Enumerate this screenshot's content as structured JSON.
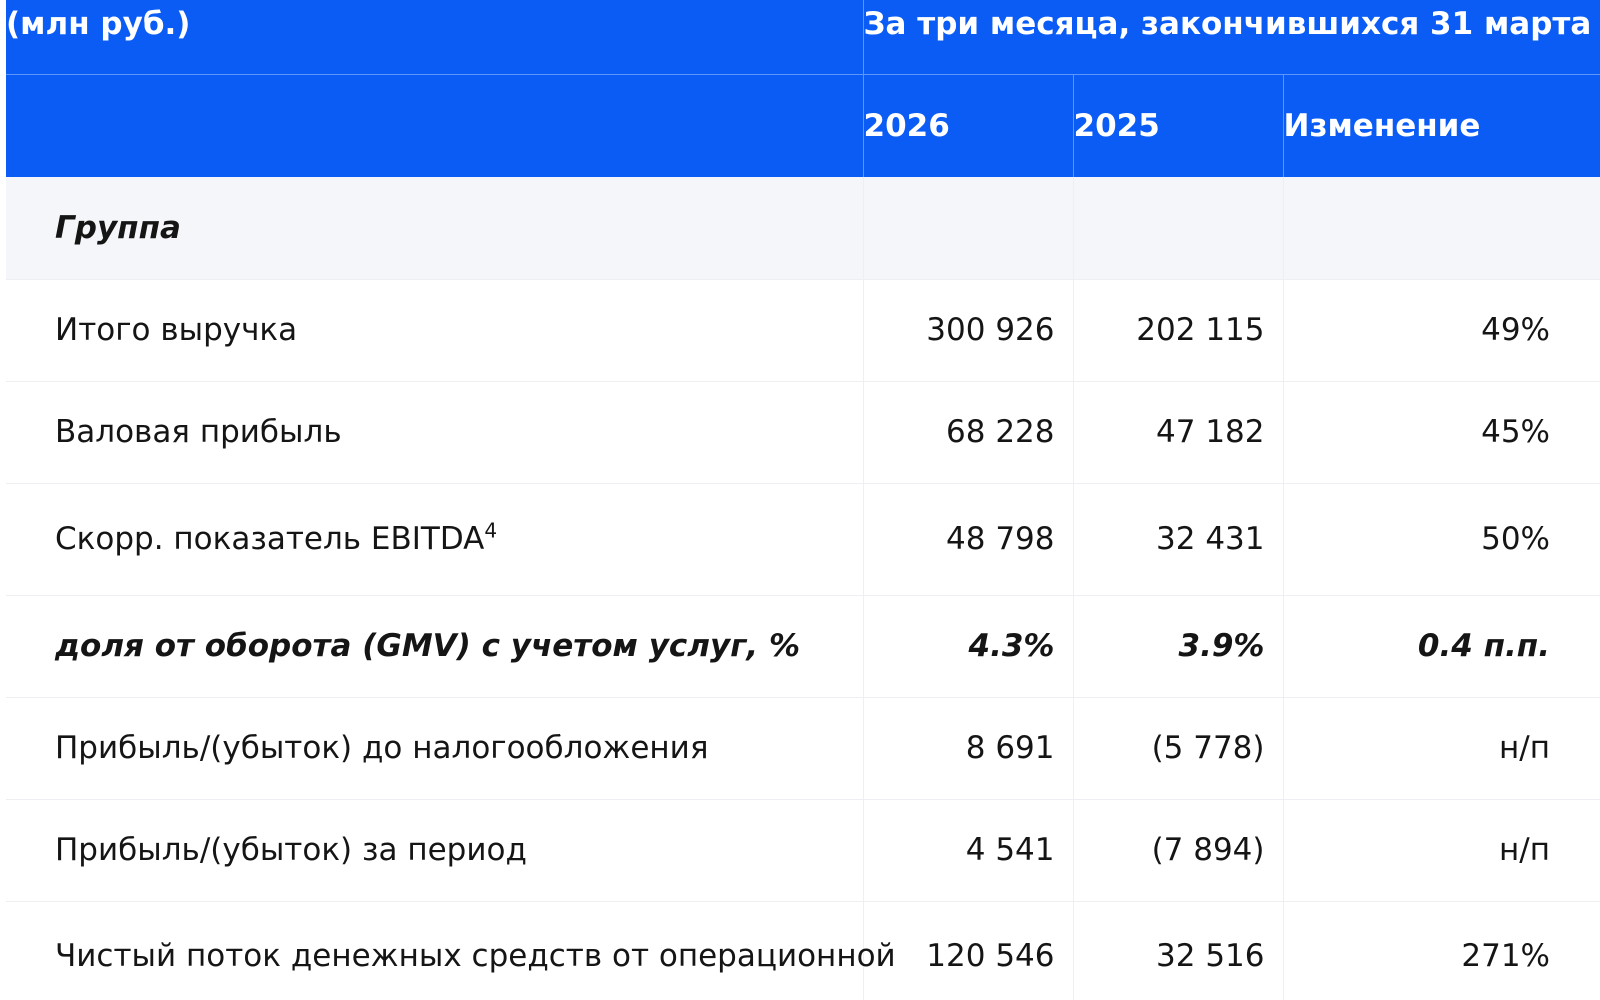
{
  "table": {
    "header": {
      "units": "(млн руб.)",
      "period": "За три месяца, закончившихся 31 марта",
      "col_2026": "2026",
      "col_2025": "2025",
      "col_change": "Изменение"
    },
    "section_title": "Группа",
    "rows": [
      {
        "label": "Итого выручка",
        "v2026": "300 926",
        "v2025": "202 115",
        "change": "49%"
      },
      {
        "label": "Валовая прибыль",
        "v2026": "68 228",
        "v2025": "47 182",
        "change": "45%"
      },
      {
        "label": "Скорр. показатель EBITDA",
        "footnote": "4",
        "v2026": "48 798",
        "v2025": "32 431",
        "change": "50%"
      },
      {
        "label": "доля от оборота (GMV) с учетом услуг, %",
        "v2026": "4.3%",
        "v2025": "3.9%",
        "change": "0.4 п.п."
      },
      {
        "label": "Прибыль/(убыток) до налогообложения",
        "v2026": "8 691",
        "v2025": "(5 778)",
        "change": "н/п"
      },
      {
        "label": "Прибыль/(убыток) за период",
        "v2026": "4 541",
        "v2025": "(7 894)",
        "change": "н/п"
      },
      {
        "label": "Чистый поток денежных средств от операционной",
        "v2026": "120 546",
        "v2025": "32 516",
        "change": "271%"
      }
    ]
  },
  "colors": {
    "header_bg": "#0a5cf5",
    "header_text": "#ffffff",
    "section_bg": "#f5f6f9",
    "row_border": "#eeeef3",
    "text": "#151515"
  }
}
